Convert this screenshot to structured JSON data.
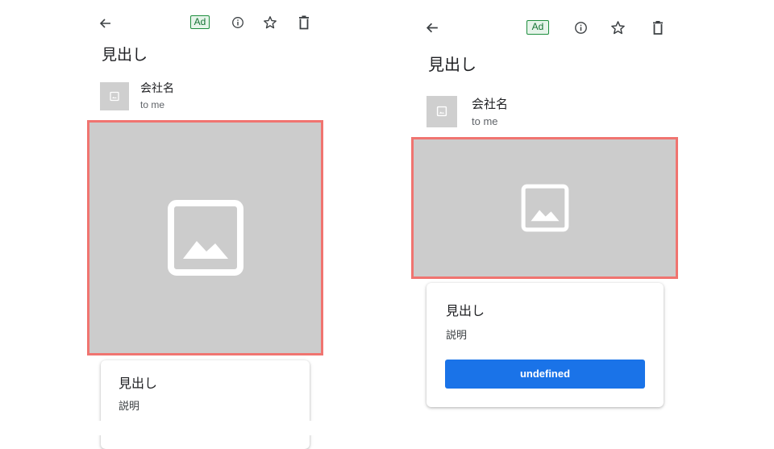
{
  "variants": [
    {
      "toolbar": {
        "back_icon": "arrow-left-icon",
        "ad_label": "Ad",
        "info_icon": "info-icon",
        "star_icon": "star-icon",
        "delete_icon": "trash-icon"
      },
      "email": {
        "headline": "見出し",
        "sender_name": "会社名",
        "recipient": "to me",
        "avatar_icon": "image-placeholder-icon"
      },
      "hero": {
        "icon": "image-placeholder-icon"
      },
      "card": {
        "title": "見出し",
        "description": "説明"
      }
    },
    {
      "toolbar": {
        "back_icon": "arrow-left-icon",
        "ad_label": "Ad",
        "info_icon": "info-icon",
        "star_icon": "star-icon",
        "delete_icon": "trash-icon"
      },
      "email": {
        "headline": "見出し",
        "sender_name": "会社名",
        "recipient": "to me",
        "avatar_icon": "image-placeholder-icon"
      },
      "hero": {
        "icon": "image-placeholder-icon"
      },
      "card": {
        "title": "見出し",
        "description": "説明",
        "cta_label": "undefined"
      }
    }
  ],
  "colors": {
    "highlight_border": "#f07470",
    "placeholder_gray": "#cccccc",
    "ad_badge_green": "#1e8e3e",
    "cta_blue": "#1a73e8"
  }
}
